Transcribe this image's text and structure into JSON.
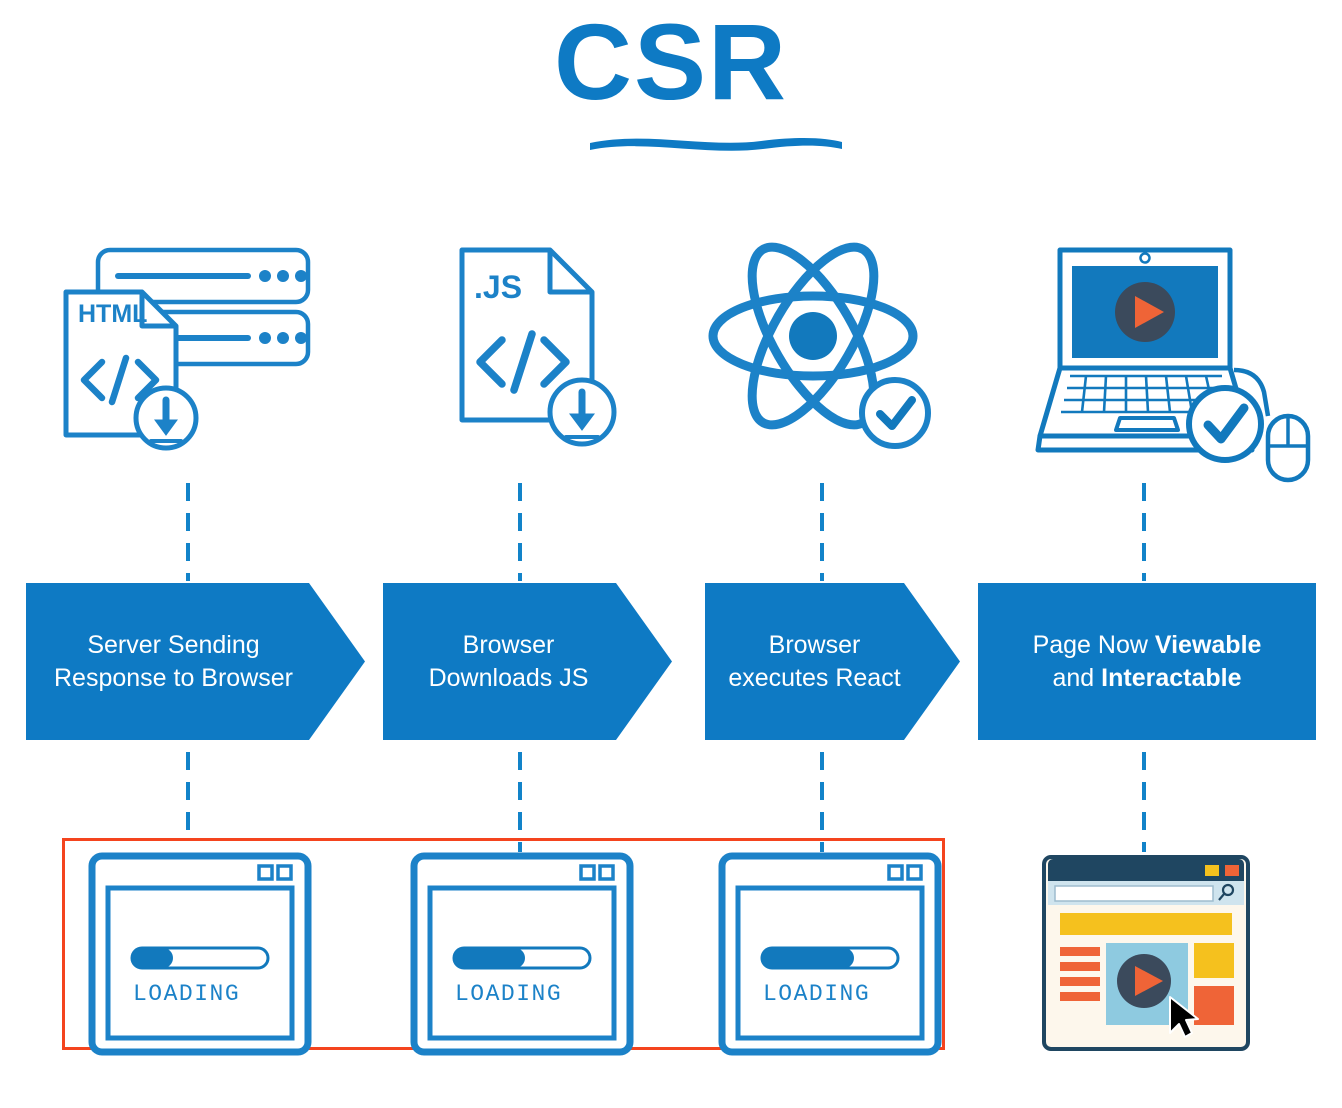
{
  "title": {
    "text": "CSR",
    "color": "#0e7ac4",
    "underline_icon": "hand-drawn-swoosh-underline"
  },
  "palette": {
    "brand_blue": "#0e7ac4",
    "sketch_blue": "#1c82c8",
    "red_outline": "#f4441e",
    "navy": "#1f4661",
    "yellow": "#f5c11e",
    "orange": "#ef6437",
    "light_blue": "#8ecae0",
    "cream": "#fdf7ec"
  },
  "icons": [
    {
      "id": "server-html",
      "name": "server-rack-with-html-file-icon",
      "doc_label": "HTML",
      "code_glyph": "</>",
      "badge": "download-arrow-badge"
    },
    {
      "id": "js-file",
      "name": "javascript-file-icon",
      "doc_label": ".JS",
      "code_glyph": "</>",
      "badge": "download-arrow-badge"
    },
    {
      "id": "react-atom",
      "name": "react-atom-icon",
      "badge": "check-badge"
    },
    {
      "id": "laptop",
      "name": "laptop-with-mouse-icon",
      "screen": "video-play-button",
      "badge": "check-badge"
    }
  ],
  "banners": [
    {
      "id": "banner-1",
      "lines": [
        "Server Sending",
        "Response to Browser"
      ],
      "shape": "arrow"
    },
    {
      "id": "banner-2",
      "lines": [
        "Browser",
        "Downloads JS"
      ],
      "shape": "arrow"
    },
    {
      "id": "banner-3",
      "lines": [
        "Browser",
        "executes React"
      ],
      "shape": "arrow"
    },
    {
      "id": "banner-4",
      "lines": [
        "Page Now ",
        "and "
      ],
      "bold": [
        "Viewable",
        "Interactable"
      ],
      "shape": "rectangle"
    }
  ],
  "banner_text": {
    "b1_l1": "Server Sending",
    "b1_l2": "Response to Browser",
    "b2_l1": "Browser",
    "b2_l2": "Downloads JS",
    "b3_l1": "Browser",
    "b3_l2": "executes React",
    "b4_l1_plain": "Page Now ",
    "b4_l1_bold": "Viewable",
    "b4_l2_plain": "and ",
    "b4_l2_bold": "Interactable"
  },
  "loaders": [
    {
      "id": "loader-1",
      "label": "LOADING",
      "progress": 30
    },
    {
      "id": "loader-2",
      "label": "LOADING",
      "progress": 52
    },
    {
      "id": "loader-3",
      "label": "LOADING",
      "progress": 68
    }
  ],
  "red_highlight": {
    "name": "blank-page-highlight-box",
    "color": "#f4441e",
    "encloses": 3
  },
  "final_browser": {
    "name": "rendered-page-browser-mockup",
    "window_buttons": [
      "yellow",
      "orange"
    ],
    "search_icon": "magnifier-icon",
    "elements": [
      "header-banner",
      "text-lines",
      "video-player",
      "side-tiles",
      "cursor-pointer"
    ]
  }
}
